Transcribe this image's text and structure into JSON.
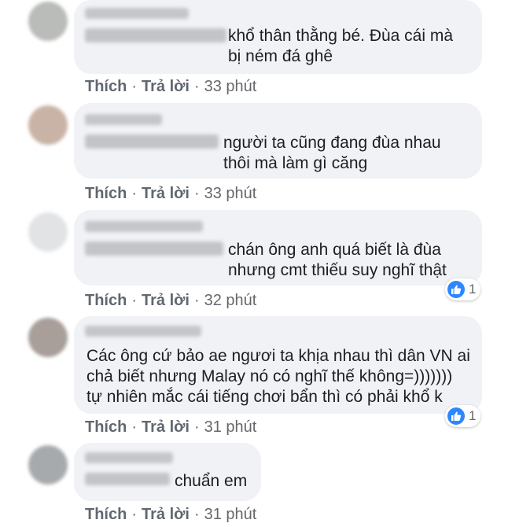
{
  "comments": [
    {
      "text": "khổ thân thằng bé. Đùa cái mà\nbị ném đá ghê",
      "actions": {
        "like": "Thích",
        "reply": "Trả lời",
        "time": "33 phút"
      },
      "reaction_count": null
    },
    {
      "text": "người ta cũng đang đùa nhau\nthôi mà làm gì căng",
      "actions": {
        "like": "Thích",
        "reply": "Trả lời",
        "time": "33 phút"
      },
      "reaction_count": null
    },
    {
      "text": "chán ông anh quá biết là đùa\nnhưng cmt thiếu suy nghĩ thật",
      "actions": {
        "like": "Thích",
        "reply": "Trả lời",
        "time": "32 phút"
      },
      "reaction_count": "1"
    },
    {
      "text": "Các ông cứ bảo ae ngươi ta khịa nhau thì dân VN ai\nchả biết nhưng Malay nó có nghĩ thế không=)))))))\ntự nhiên mắc cái tiếng chơi bẩn thì có phải khổ k",
      "actions": {
        "like": "Thích",
        "reply": "Trả lời",
        "time": "31 phút"
      },
      "reaction_count": "1"
    },
    {
      "text": "chuẩn em",
      "actions": {
        "like": "Thích",
        "reply": "Trả lời",
        "time": "31 phút"
      },
      "reaction_count": null
    }
  ],
  "separator": "·",
  "reaction_icon": "thumbs-up-icon",
  "colors": {
    "bubble": "#f0f2f5",
    "like_blue": "#2d88ff",
    "action_gray": "#606770"
  }
}
